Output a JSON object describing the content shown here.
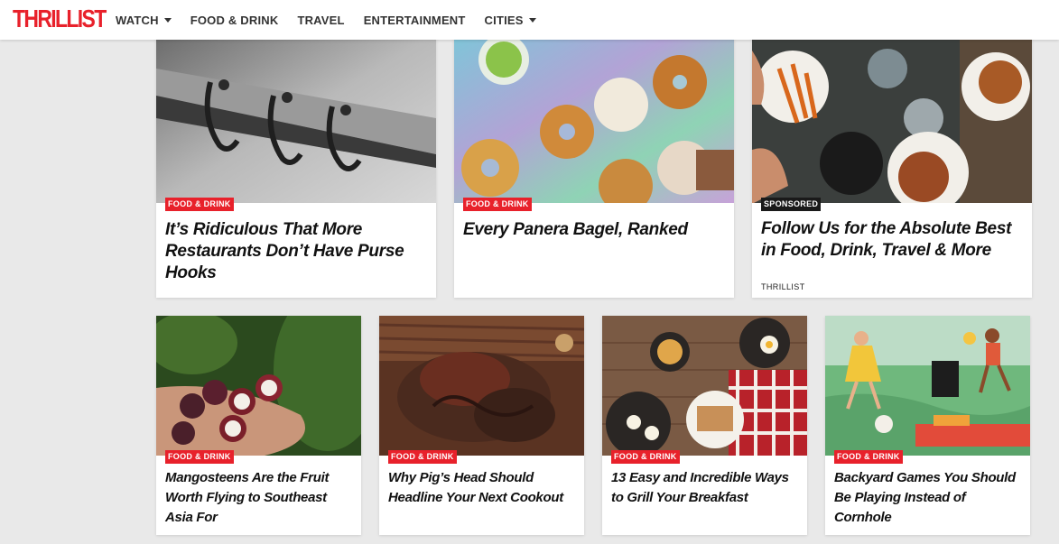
{
  "brand": {
    "logo": "THRILLIST",
    "color": "#e8212b"
  },
  "nav": {
    "items": [
      {
        "label": "WATCH",
        "dropdown": true
      },
      {
        "label": "FOOD & DRINK",
        "dropdown": false
      },
      {
        "label": "TRAVEL",
        "dropdown": false
      },
      {
        "label": "ENTERTAINMENT",
        "dropdown": false
      },
      {
        "label": "CITIES",
        "dropdown": true
      }
    ]
  },
  "articles_top": [
    {
      "category": "FOOD & DRINK",
      "title": "It’s Ridiculous That More Restaurants Don’t Have Purse Hooks",
      "image": "purse-hooks-photo"
    },
    {
      "category": "FOOD & DRINK",
      "title": "Every Panera Bagel, Ranked",
      "image": "bagels-photo"
    },
    {
      "category": "SPONSORED",
      "title": "Follow Us for the Absolute Best in Food, Drink, Travel & More",
      "byline": "THRILLIST",
      "image": "food-table-photo"
    }
  ],
  "articles_bottom": [
    {
      "category": "FOOD & DRINK",
      "title": "Mangosteens Are the Fruit Worth Flying to Southeast Asia For",
      "image": "mangosteens-photo"
    },
    {
      "category": "FOOD & DRINK",
      "title": "Why Pig’s Head Should Headline Your Next Cookout",
      "image": "pigs-head-photo"
    },
    {
      "category": "FOOD & DRINK",
      "title": "13 Easy and Incredible Ways to Grill Your Breakfast",
      "image": "grilled-breakfast-photo"
    },
    {
      "category": "FOOD & DRINK",
      "title": "Backyard Games You Should Be Playing Instead of Cornhole",
      "image": "backyard-games-illustration"
    }
  ]
}
